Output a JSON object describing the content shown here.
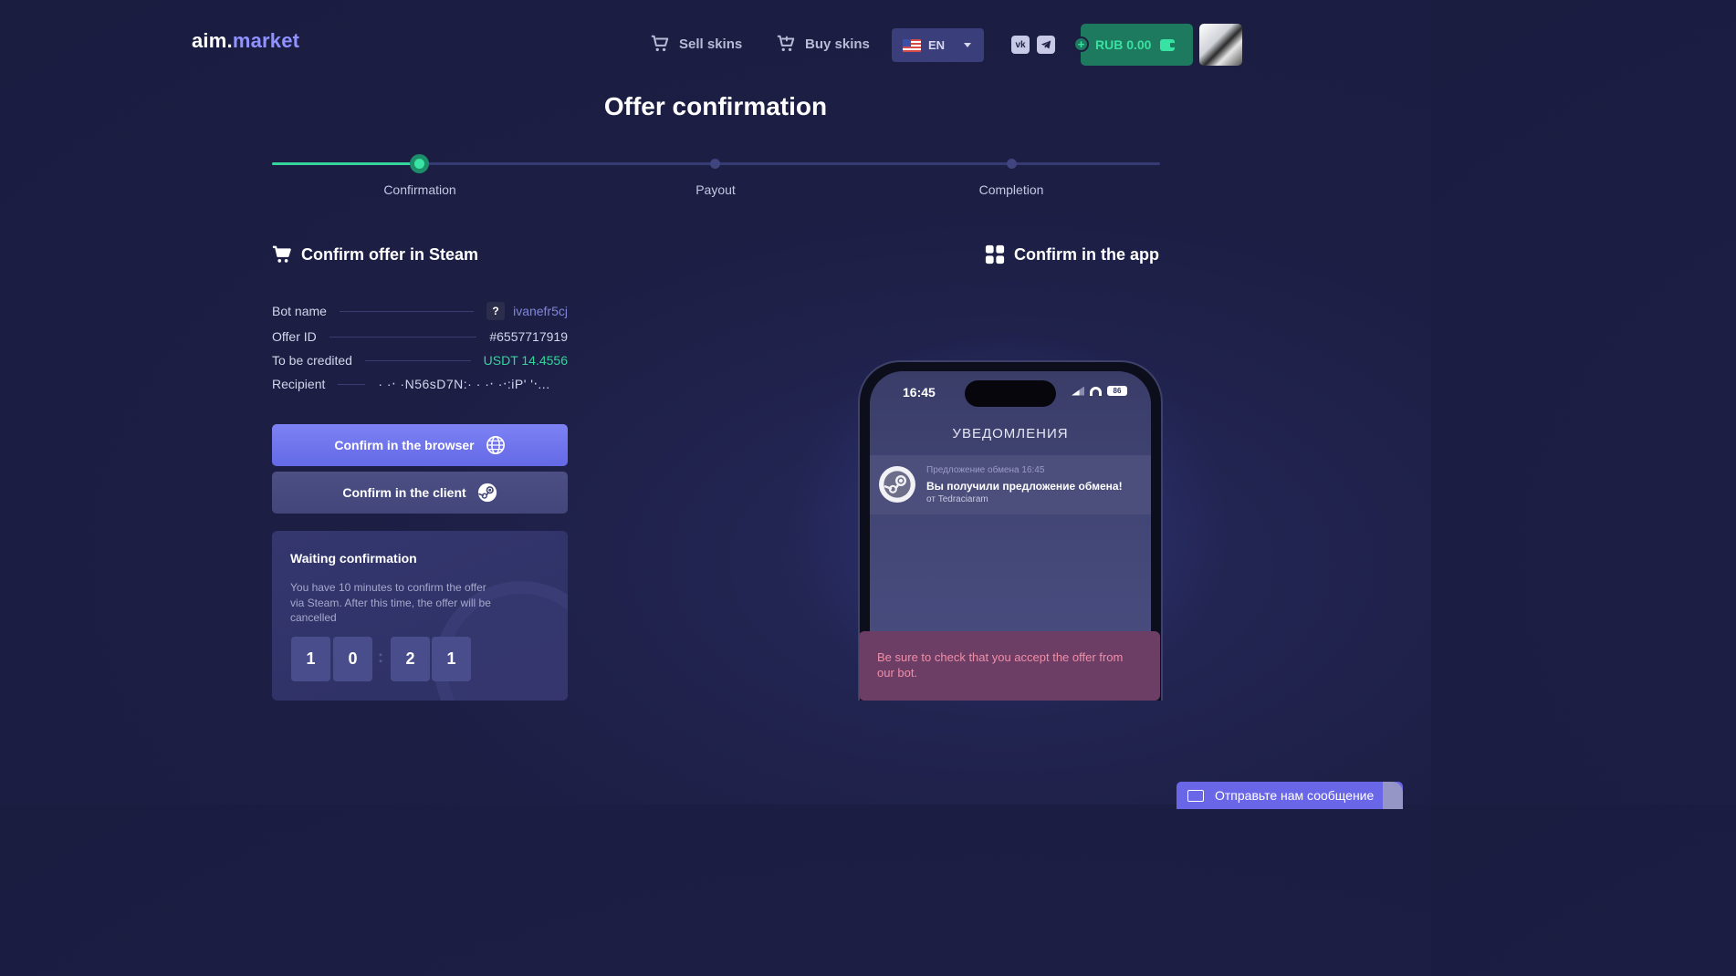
{
  "header": {
    "logo_part1": "aim.",
    "logo_part2": "market",
    "nav_sell": "Sell skins",
    "nav_buy": "Buy skins",
    "language": "EN",
    "balance": "RUB 0.00",
    "social": [
      "vk-icon",
      "telegram-icon"
    ]
  },
  "page": {
    "title": "Offer confirmation"
  },
  "steps": [
    {
      "label": "Confirmation",
      "state": "active"
    },
    {
      "label": "Payout",
      "state": "pending"
    },
    {
      "label": "Completion",
      "state": "pending"
    }
  ],
  "steam_section": {
    "heading": "Confirm offer in Steam",
    "rows": [
      {
        "label": "Bot name",
        "badge": "?",
        "value": "ivanefr5cj"
      },
      {
        "label": "Offer ID",
        "value": "#6557717919"
      },
      {
        "label": "To be credited",
        "value": "USDT 14.4556"
      },
      {
        "label": "Recipient",
        "value": "· ·‧ ·N56sD7N:· · ·‧ ·‧:iP' '‧..."
      }
    ],
    "btn_browser": "Confirm in the browser",
    "btn_client": "Confirm in the client"
  },
  "waiting": {
    "title": "Waiting confirmation",
    "text": "You have 10 minutes to confirm the offer via Steam. After this time, the offer will be cancelled",
    "digits": [
      "1",
      "0",
      "2",
      "1"
    ],
    "separator": ":"
  },
  "app_section": {
    "heading": "Confirm in the app",
    "phone": {
      "time": "16:45",
      "battery": "86",
      "heading": "УВЕДОМЛЕНИЯ",
      "notif_meta": "Предложение обмена 16:45",
      "notif_title": "Вы получили предложение обмена!",
      "notif_from": "от Tedraciaram"
    },
    "warning": "Be sure to check that you accept the offer from our bot."
  },
  "chat": {
    "label": "Отправьте нам сообщение"
  },
  "colors": {
    "accent": "#6469e6",
    "success": "#35d49b",
    "background": "#1c1e44"
  }
}
